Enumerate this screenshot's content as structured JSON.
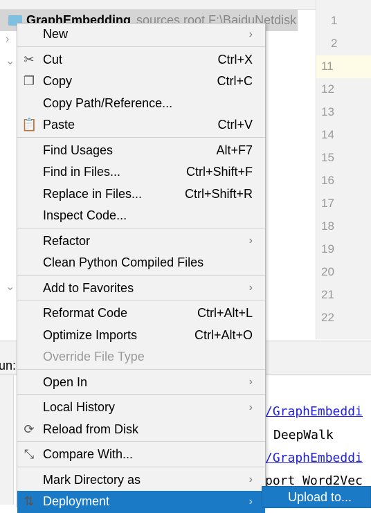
{
  "project_tree": {
    "name": "GraphEmbedding",
    "meta": "sources root  F:\\BaiduNetdisk"
  },
  "editor": {
    "line_numbers": [
      "1",
      "2",
      "11",
      "12",
      "13",
      "14",
      "15",
      "16",
      "17",
      "18",
      "19",
      "20",
      "21",
      "22"
    ]
  },
  "run_panel": {
    "label": "un:",
    "output": [
      "/GraphEmbeddi",
      "DeepWalk",
      "/GraphEmbeddi",
      "port Word2Vec"
    ]
  },
  "context_menu": {
    "groups": [
      [
        {
          "label": "New",
          "arrow": true
        }
      ],
      [
        {
          "label": "Cut",
          "shortcut": "Ctrl+X",
          "icon": "scissors-icon"
        },
        {
          "label": "Copy",
          "shortcut": "Ctrl+C",
          "icon": "copy-icon"
        },
        {
          "label": "Copy Path/Reference..."
        },
        {
          "label": "Paste",
          "shortcut": "Ctrl+V",
          "icon": "paste-icon"
        }
      ],
      [
        {
          "label": "Find Usages",
          "shortcut": "Alt+F7"
        },
        {
          "label": "Find in Files...",
          "shortcut": "Ctrl+Shift+F"
        },
        {
          "label": "Replace in Files...",
          "shortcut": "Ctrl+Shift+R"
        },
        {
          "label": "Inspect Code..."
        }
      ],
      [
        {
          "label": "Refactor",
          "arrow": true
        },
        {
          "label": "Clean Python Compiled Files"
        }
      ],
      [
        {
          "label": "Add to Favorites",
          "arrow": true
        }
      ],
      [
        {
          "label": "Reformat Code",
          "shortcut": "Ctrl+Alt+L"
        },
        {
          "label": "Optimize Imports",
          "shortcut": "Ctrl+Alt+O"
        },
        {
          "label": "Override File Type",
          "disabled": true
        }
      ],
      [
        {
          "label": "Open In",
          "arrow": true
        }
      ],
      [
        {
          "label": "Local History",
          "arrow": true
        },
        {
          "label": "Reload from Disk",
          "icon": "reload-icon"
        }
      ],
      [
        {
          "label": "Compare With...",
          "icon": "compare-icon"
        }
      ],
      [
        {
          "label": "Mark Directory as",
          "arrow": true
        },
        {
          "label": "Deployment",
          "arrow": true,
          "icon": "deployment-icon",
          "selected": true
        }
      ]
    ]
  },
  "submenu": {
    "label": "Upload to..."
  },
  "colors": {
    "selection": "#1b7ac5",
    "menu_bg": "#f2f2f2",
    "link": "#2020e0"
  }
}
